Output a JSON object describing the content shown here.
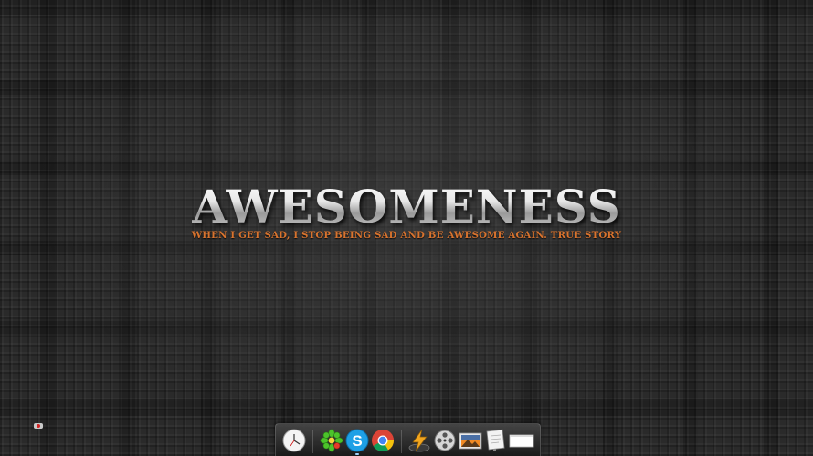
{
  "wallpaper": {
    "headline": "AWESOMENESS",
    "tagline": "WHEN I GET SAD, I STOP BEING SAD AND BE AWESOME AGAIN. TRUE STORY",
    "tagline_color": "#d8732e",
    "background_color": "#2a2a2a"
  },
  "tray": {
    "icon": "tray-indicator-icon"
  },
  "dock": {
    "items": [
      {
        "name": "clock",
        "icon": "clock-icon"
      },
      {
        "name": "icq",
        "icon": "icq-flower-icon"
      },
      {
        "name": "skype",
        "icon": "skype-icon"
      },
      {
        "name": "chrome",
        "icon": "chrome-icon"
      },
      {
        "name": "winamp",
        "icon": "winamp-lightning-icon"
      },
      {
        "name": "film",
        "icon": "film-reel-icon"
      },
      {
        "name": "photos",
        "icon": "photo-frame-icon"
      },
      {
        "name": "notepad",
        "icon": "notepad-icon"
      },
      {
        "name": "blank-window",
        "icon": "window-icon"
      }
    ]
  }
}
